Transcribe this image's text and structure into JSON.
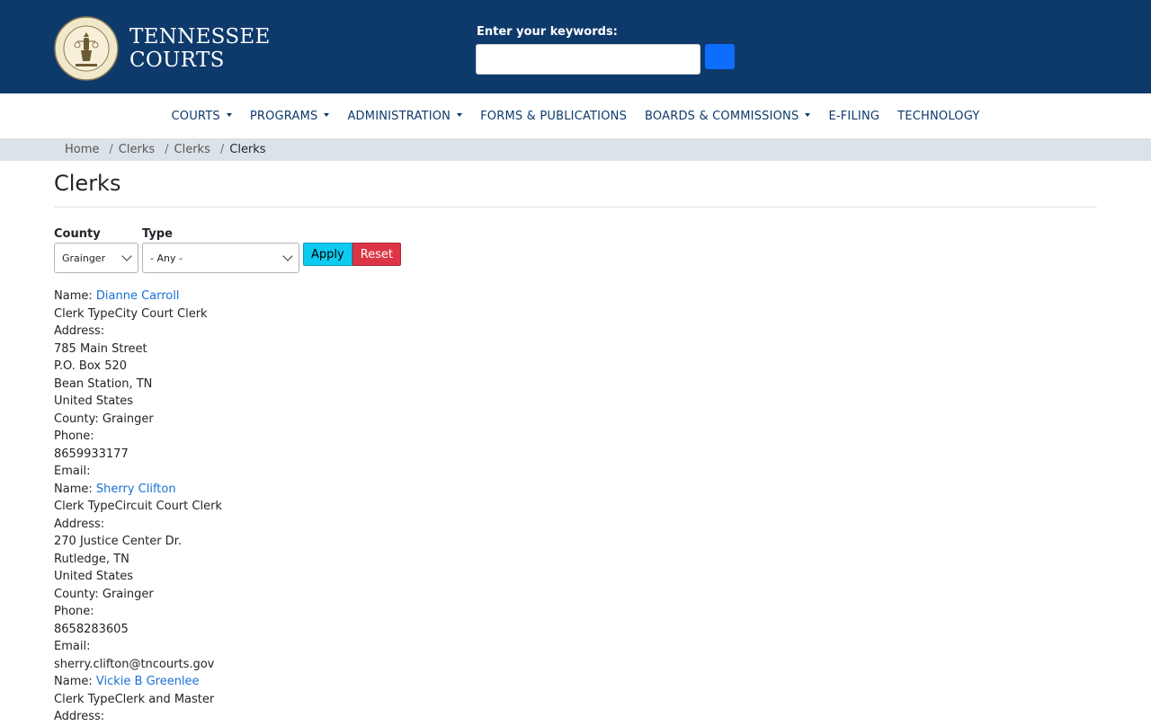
{
  "header": {
    "brand_line1": "TENNESSEE",
    "brand_line2": "COURTS",
    "seal_text": "SEAL OF THE TENNESSEE JUDICIARY",
    "search_label": "Enter your keywords:",
    "search_value": ""
  },
  "nav": {
    "items": [
      {
        "label": "COURTS",
        "dropdown": true
      },
      {
        "label": "PROGRAMS",
        "dropdown": true
      },
      {
        "label": "ADMINISTRATION",
        "dropdown": true
      },
      {
        "label": "FORMS & PUBLICATIONS",
        "dropdown": false
      },
      {
        "label": "BOARDS & COMMISSIONS",
        "dropdown": true
      },
      {
        "label": "E-FILING",
        "dropdown": false
      },
      {
        "label": "TECHNOLOGY",
        "dropdown": false
      }
    ]
  },
  "breadcrumb": [
    "Home",
    "Clerks",
    "Clerks",
    "Clerks"
  ],
  "page": {
    "title": "Clerks"
  },
  "filters": {
    "county_label": "County",
    "county_value": "Grainger",
    "type_label": "Type",
    "type_value": "- Any -",
    "apply_label": "Apply",
    "reset_label": "Reset"
  },
  "labels": {
    "name": "Name: ",
    "clerk_type": "Clerk Type",
    "address": "Address:",
    "phone": "Phone:",
    "email": "Email:"
  },
  "clerks": [
    {
      "name": "Dianne Carroll",
      "type": "City Court Clerk",
      "address": [
        "785 Main Street",
        "P.O. Box 520",
        "Bean Station, TN",
        "United States"
      ],
      "county": "County: Grainger",
      "phone": "8659933177",
      "email": ""
    },
    {
      "name": "Sherry Clifton",
      "type": "Circuit Court Clerk",
      "address": [
        "270 Justice Center Dr.",
        "Rutledge, TN",
        "United States"
      ],
      "county": "County: Grainger",
      "phone": "8658283605",
      "email": "sherry.clifton@tncourts.gov"
    },
    {
      "name": "Vickie B Greenlee",
      "type": "Clerk and Master",
      "address": [],
      "county": "",
      "phone": "",
      "email": ""
    }
  ],
  "colors": {
    "header_bg": "#0e3a6b",
    "search_button": "#0d6efd",
    "apply_button": "#0dcaf0",
    "reset_button": "#dc3545",
    "link": "#1a6fd4",
    "breadcrumb_bg": "#dbe2e8"
  }
}
